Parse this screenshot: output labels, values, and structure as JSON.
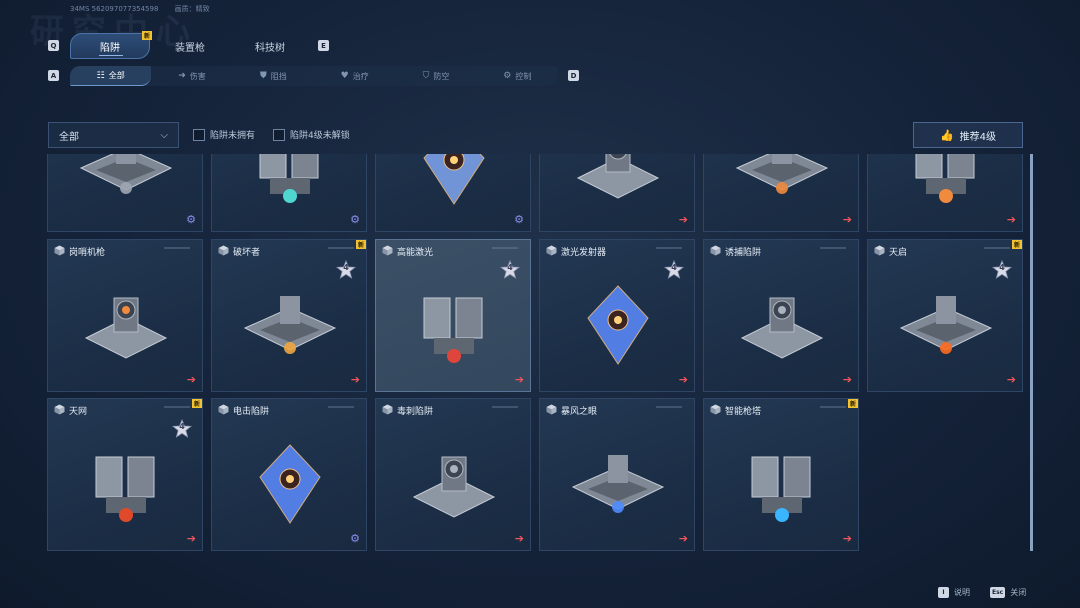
{
  "header": {
    "bg_title": "研究中心",
    "meta_id": "34MS  562097077354598",
    "meta_quality": "画质：精致"
  },
  "tabs": {
    "prev_key": "Q",
    "next_key": "E",
    "items": [
      {
        "label": "陷阱",
        "active": true,
        "new": true
      },
      {
        "label": "装置枪",
        "active": false,
        "new": false
      },
      {
        "label": "科技树",
        "active": false,
        "new": false
      }
    ]
  },
  "filters": {
    "prev_key": "A",
    "next_key": "D",
    "items": [
      {
        "label": "全部",
        "icon": "grid-icon",
        "active": true
      },
      {
        "label": "伤害",
        "icon": "damage-arrow-icon",
        "active": false
      },
      {
        "label": "阻挡",
        "icon": "shield-icon",
        "active": false
      },
      {
        "label": "治疗",
        "icon": "heart-icon",
        "active": false
      },
      {
        "label": "防空",
        "icon": "anti-air-icon",
        "active": false
      },
      {
        "label": "控制",
        "icon": "gear-icon",
        "active": false
      }
    ]
  },
  "toolbar": {
    "dropdown_value": "全部",
    "checkbox_not_owned": "陷阱未拥有",
    "checkbox_level4_locked": "陷阱4级未解锁",
    "recommend_label": "推荐4级"
  },
  "new_badge_text": "新",
  "level_badge_text": "4",
  "cards_top_row": [
    {
      "corner": "gear",
      "color": "#9fa6b1"
    },
    {
      "corner": "gear",
      "color": "#4fd6d0"
    },
    {
      "corner": "gear",
      "color": "#7fa6f0"
    },
    {
      "corner": "arrow",
      "color": "#9aa1ab"
    },
    {
      "corner": "arrow",
      "color": "#f08a3c"
    },
    {
      "corner": "arrow",
      "color": "#f08a3c"
    }
  ],
  "cards": [
    {
      "name": "岗哨机枪",
      "new": false,
      "level4": false,
      "corner": "arrow",
      "art_color": "#f08a3c",
      "highlight": false
    },
    {
      "name": "破坏者",
      "new": true,
      "level4": true,
      "corner": "arrow",
      "art_color": "#f0a640",
      "highlight": false
    },
    {
      "name": "高能激光",
      "new": false,
      "level4": true,
      "corner": "arrow",
      "art_color": "#e0453c",
      "highlight": true
    },
    {
      "name": "激光发射器",
      "new": false,
      "level4": true,
      "corner": "arrow",
      "art_color": "#5c8cff",
      "highlight": false
    },
    {
      "name": "诱捕陷阱",
      "new": false,
      "level4": false,
      "corner": "arrow",
      "art_color": "#a9b2bd",
      "highlight": false
    },
    {
      "name": "天启",
      "new": true,
      "level4": true,
      "corner": "arrow",
      "art_color": "#ff6a1e",
      "highlight": false
    },
    {
      "name": "天网",
      "new": true,
      "level4": true,
      "corner": "arrow",
      "art_color": "#e04a2a",
      "highlight": false
    },
    {
      "name": "电击陷阱",
      "new": false,
      "level4": false,
      "corner": "gear",
      "art_color": "#5c8cff",
      "highlight": false
    },
    {
      "name": "毒刺陷阱",
      "new": false,
      "level4": false,
      "corner": "arrow",
      "art_color": "#a9b2bd",
      "highlight": false
    },
    {
      "name": "暴风之眼",
      "new": false,
      "level4": false,
      "corner": "arrow",
      "art_color": "#4f8cff",
      "highlight": false
    },
    {
      "name": "智能枪塔",
      "new": true,
      "level4": false,
      "corner": "arrow",
      "art_color": "#39b6ff",
      "highlight": false
    }
  ],
  "footer": {
    "help_key": "I",
    "help_label": "说明",
    "close_key": "Esc",
    "close_label": "关闭"
  },
  "colors": {
    "accent": "#4a74a8",
    "new_badge": "#f2c331",
    "arrow_red": "#f0545b",
    "gear_purple": "#8c8ff0"
  }
}
